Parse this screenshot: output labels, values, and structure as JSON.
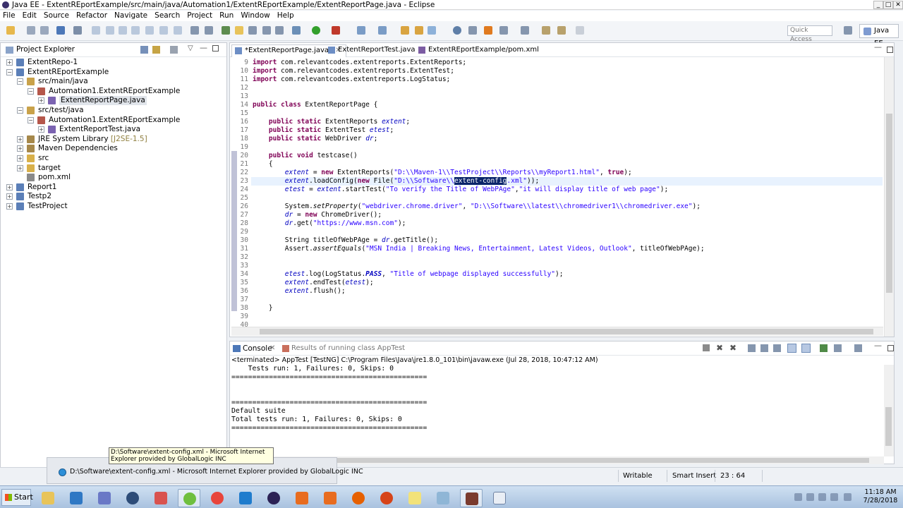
{
  "window": {
    "title": "Java EE - ExtentREportExample/src/main/java/Automation1/ExtentREportExample/ExtentReportPage.java - Eclipse",
    "minimize": "_",
    "maximize": "□",
    "close": "✕"
  },
  "menu": [
    "File",
    "Edit",
    "Source",
    "Refactor",
    "Navigate",
    "Search",
    "Project",
    "Run",
    "Window",
    "Help"
  ],
  "toolbar": {
    "quick_access_placeholder": "Quick Access",
    "perspective": "Java EE"
  },
  "explorer": {
    "title": "Project Explorer",
    "tree": [
      {
        "label": "ExtentRepo-1",
        "depth": 0,
        "expander": "+",
        "icon": "project-icon"
      },
      {
        "label": "ExtentREportExample",
        "depth": 0,
        "expander": "−",
        "icon": "project-icon"
      },
      {
        "label": "src/main/java",
        "depth": 1,
        "expander": "−",
        "icon": "source-folder-icon"
      },
      {
        "label": "Automation1.ExtentREportExample",
        "depth": 2,
        "expander": "−",
        "icon": "package-icon"
      },
      {
        "label": "ExtentReportPage.java",
        "depth": 3,
        "expander": "+",
        "icon": "java-file-icon",
        "selected": true
      },
      {
        "label": "src/test/java",
        "depth": 1,
        "expander": "−",
        "icon": "source-folder-icon"
      },
      {
        "label": "Automation1.ExtentREportExample",
        "depth": 2,
        "expander": "−",
        "icon": "package-icon"
      },
      {
        "label": "ExtentReportTest.java",
        "depth": 3,
        "expander": "+",
        "icon": "java-file-icon"
      },
      {
        "label": "JRE System Library",
        "decoration": "[J2SE-1.5]",
        "depth": 1,
        "expander": "+",
        "icon": "library-icon"
      },
      {
        "label": "Maven Dependencies",
        "depth": 1,
        "expander": "+",
        "icon": "library-icon"
      },
      {
        "label": "src",
        "depth": 1,
        "expander": "+",
        "icon": "folder-icon"
      },
      {
        "label": "target",
        "depth": 1,
        "expander": "+",
        "icon": "folder-icon"
      },
      {
        "label": "pom.xml",
        "depth": 1,
        "expander": "",
        "icon": "xml-file-icon"
      },
      {
        "label": "Report1",
        "depth": 0,
        "expander": "+",
        "icon": "project-icon"
      },
      {
        "label": "Testp2",
        "depth": 0,
        "expander": "+",
        "icon": "project-icon"
      },
      {
        "label": "TestProject",
        "depth": 0,
        "expander": "+",
        "icon": "project-icon"
      }
    ]
  },
  "editor": {
    "tabs": [
      {
        "label": "*ExtentReportPage.java",
        "active": true
      },
      {
        "label": "ExtentReportTest.java",
        "active": false
      },
      {
        "label": "ExtentREportExample/pom.xml",
        "active": false
      }
    ],
    "current_line": 23,
    "lines": [
      {
        "n": "9",
        "code": "import com.relevantcodes.extentreports.ExtentReports;"
      },
      {
        "n": "10",
        "code": "import com.relevantcodes.extentreports.ExtentTest;"
      },
      {
        "n": "11",
        "code": "import com.relevantcodes.extentreports.LogStatus;"
      },
      {
        "n": "12",
        "code": ""
      },
      {
        "n": "13",
        "code": ""
      },
      {
        "n": "14",
        "code": "public class ExtentReportPage {"
      },
      {
        "n": "15",
        "code": ""
      },
      {
        "n": "16",
        "code": "    public static ExtentReports extent;"
      },
      {
        "n": "17",
        "code": "    public static ExtentTest etest;"
      },
      {
        "n": "18",
        "code": "    public static WebDriver dr;"
      },
      {
        "n": "19",
        "code": ""
      },
      {
        "n": "20",
        "code": "    public void testcase()"
      },
      {
        "n": "21",
        "code": "    {"
      },
      {
        "n": "22",
        "code": "        extent = new ExtentReports(\"D:\\\\Maven-1\\\\TestProject\\\\Reports\\\\myReport1.html\", true);"
      },
      {
        "n": "23",
        "code": "        extent.loadConfig(new File(\"D:\\\\Software\\\\extent-config.xml\"));"
      },
      {
        "n": "24",
        "code": "        etest = extent.startTest(\"To verify the Title of WebPAge\",\"it will display title of web page\");"
      },
      {
        "n": "25",
        "code": ""
      },
      {
        "n": "26",
        "code": "        System.setProperty(\"webdriver.chrome.driver\", \"D:\\\\Software\\\\latest\\\\chromedriver1\\\\chromedriver.exe\");"
      },
      {
        "n": "27",
        "code": "        dr = new ChromeDriver();"
      },
      {
        "n": "28",
        "code": "        dr.get(\"https://www.msn.com\");"
      },
      {
        "n": "29",
        "code": ""
      },
      {
        "n": "30",
        "code": "        String titleOfWebPAge = dr.getTitle();"
      },
      {
        "n": "31",
        "code": "        Assert.assertEquals(\"MSN India | Breaking News, Entertainment, Latest Videos, Outlook\", titleOfWebPAge);"
      },
      {
        "n": "32",
        "code": ""
      },
      {
        "n": "33",
        "code": ""
      },
      {
        "n": "34",
        "code": "        etest.log(LogStatus.PASS, \"Title of webpage displayed successfully\");"
      },
      {
        "n": "35",
        "code": "        extent.endTest(etest);"
      },
      {
        "n": "36",
        "code": "        extent.flush();"
      },
      {
        "n": "37",
        "code": ""
      },
      {
        "n": "38",
        "code": "    }"
      },
      {
        "n": "39",
        "code": ""
      },
      {
        "n": "40",
        "code": ""
      }
    ]
  },
  "console": {
    "tab": "Console",
    "results_tab": "Results of running class AppTest",
    "terminated": "<terminated> AppTest [TestNG] C:\\Program Files\\Java\\jre1.8.0_101\\bin\\javaw.exe (Jul 28, 2018, 10:47:12 AM)",
    "output": [
      "    Tests run: 1, Failures: 0, Skips: 0",
      "===============================================",
      "",
      "",
      "===============================================",
      "Default suite",
      "Total tests run: 1, Failures: 0, Skips: 0",
      "==============================================="
    ]
  },
  "status": {
    "writable": "Writable",
    "insert_mode": "Smart Insert",
    "position": "23 : 64"
  },
  "tooltip": "D:\\Software\\extent-config.xml - Microsoft Internet Explorer provided by GlobalLogic INC",
  "taskbar_preview": "D:\\Software\\extent-config.xml - Microsoft Internet Explorer provided by GlobalLogic INC",
  "taskbar": {
    "start": "Start",
    "time": "11:18 AM",
    "date": "7/28/2018"
  },
  "colors": {
    "keyword": "#7f0055",
    "string": "#2a00ff",
    "field": "#0000c0",
    "selection": "#0a246a"
  }
}
